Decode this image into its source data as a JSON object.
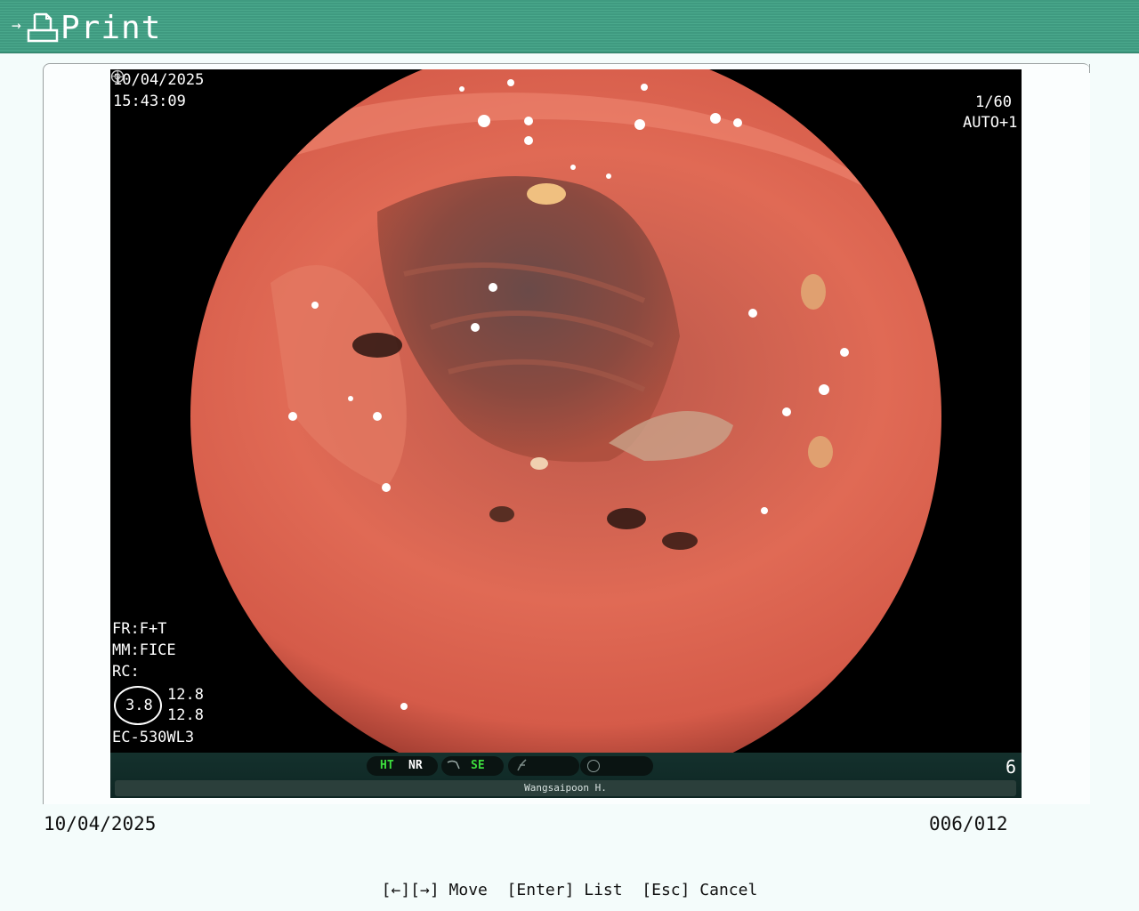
{
  "titlebar": {
    "title": "Print",
    "arrow": "→"
  },
  "image_overlay": {
    "date": "10/04/2025",
    "time": "15:43:09",
    "shutter": "1/60",
    "iris": "AUTO+1",
    "fr": "FR:F+T",
    "mm": "MM:FICE",
    "rc": "RC:",
    "ring_value": "3.8",
    "value1": "12.8",
    "value2": "12.8",
    "model": "EC-530WL3"
  },
  "status": {
    "ht": "HT",
    "nr": "NR",
    "se": "SE",
    "number": "6",
    "operator": "Wangsaipoon H."
  },
  "footer": {
    "date": "10/04/2025",
    "counter": "006/012",
    "help": "[←][→] Move  [Enter] List  [Esc] Cancel"
  },
  "colors": {
    "title_bar": "#3f9a80",
    "status_green": "#3ddc3d"
  }
}
